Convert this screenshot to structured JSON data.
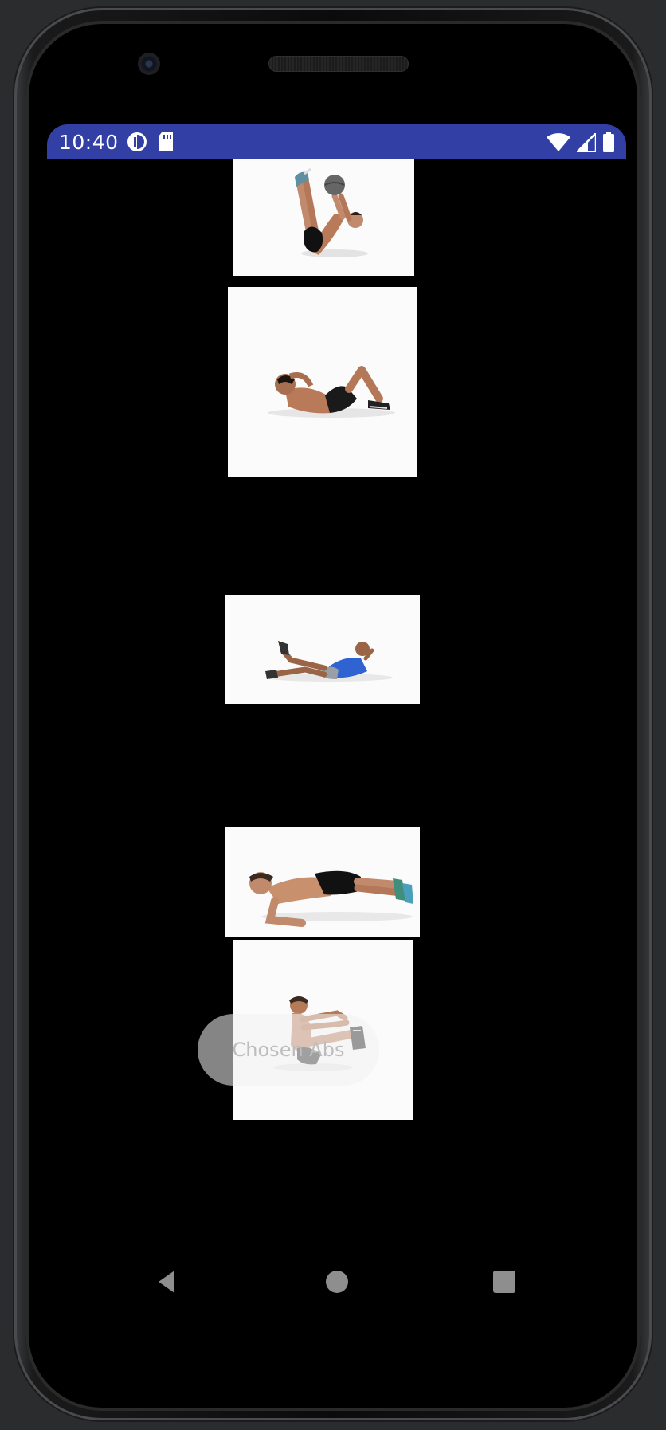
{
  "status_bar": {
    "time": "10:40",
    "left_icons": [
      "data-saver-icon",
      "sd-card-icon"
    ],
    "right_icons": [
      "wifi-icon",
      "cellular-signal-icon",
      "battery-icon"
    ],
    "color": "#3240a6"
  },
  "exercises": [
    {
      "image": "medicine-ball-toe-touch-image"
    },
    {
      "image": "crunch-image"
    },
    {
      "image": "bicycle-crunch-image"
    },
    {
      "image": "forearm-plank-image"
    },
    {
      "image": "v-sit-hold-image"
    }
  ],
  "toast": {
    "text": "Chosen Abs"
  },
  "navigation": {
    "back_icon": "back-triangle-icon",
    "home_icon": "home-circle-icon",
    "recents_icon": "recents-square-icon"
  }
}
